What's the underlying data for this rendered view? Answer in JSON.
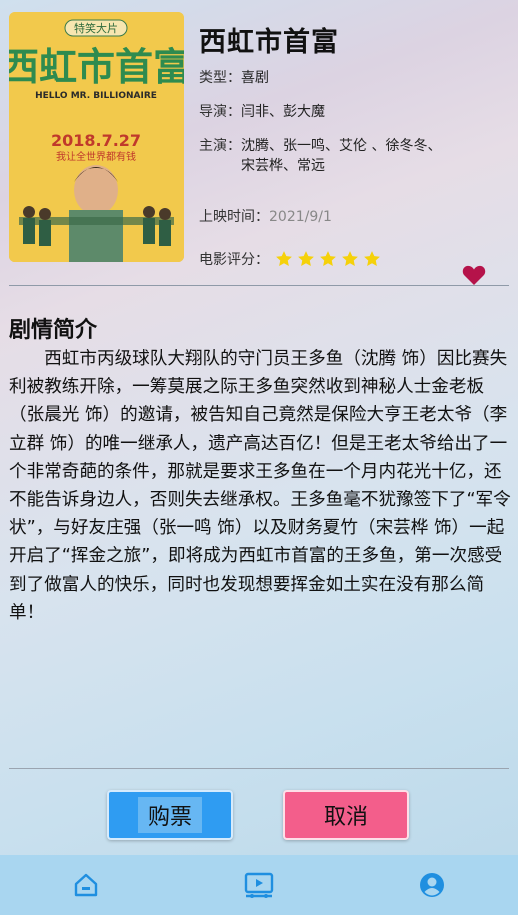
{
  "movie": {
    "title": "西虹市首富",
    "poster": {
      "tagline": "特笑大片",
      "title": "西虹市首富",
      "english": "HELLO MR. BILLIONAIRE",
      "date": "2018.7.27",
      "subtitle": "我让全世界都有钱",
      "bg_color": "#f2c94c"
    },
    "type_label": "类型：",
    "type_value": "喜剧",
    "director_label": "导演：",
    "director_value": "闫非、彭大魔",
    "cast_label": "主演：",
    "cast_line1": "沈腾、张一鸣、艾伦 、徐冬冬、",
    "cast_line2": "宋芸桦、常远",
    "date_label": "上映时间：",
    "date_value": "2021/9/1",
    "rating_label": "电影评分：",
    "rating_stars": 5,
    "star_color": "#f5d10a",
    "heart_color": "#b5134a"
  },
  "synopsis": {
    "heading": "剧情简介",
    "text": "西虹市丙级球队大翔队的守门员王多鱼（沈腾 饰）因比赛失利被教练开除，一筹莫展之际王多鱼突然收到神秘人士金老板（张晨光 饰）的邀请，被告知自己竟然是保险大亨王老太爷（李立群 饰）的唯一继承人，遗产高达百亿！但是王老太爷给出了一个非常奇葩的条件，那就是要求王多鱼在一个月内花光十亿，还不能告诉身边人，否则失去继承权。王多鱼毫不犹豫签下了“军令状”，与好友庄强（张一鸣 饰）以及财务夏竹（宋芸桦 饰）一起开启了“挥金之旅”，即将成为西虹市首富的王多鱼，第一次感受到了做富人的快乐，同时也发现想要挥金如土实在没有那么简单！"
  },
  "actions": {
    "buy_label": "购票",
    "cancel_label": "取消",
    "buy_color": "#2f9cf2",
    "cancel_color": "#f35e8b"
  },
  "tabbar": {
    "items": [
      {
        "icon": "home-icon"
      },
      {
        "icon": "movie-icon"
      },
      {
        "icon": "user-icon"
      }
    ],
    "icon_color": "#1f8fe0",
    "bg_color": "#a9d6f0"
  }
}
